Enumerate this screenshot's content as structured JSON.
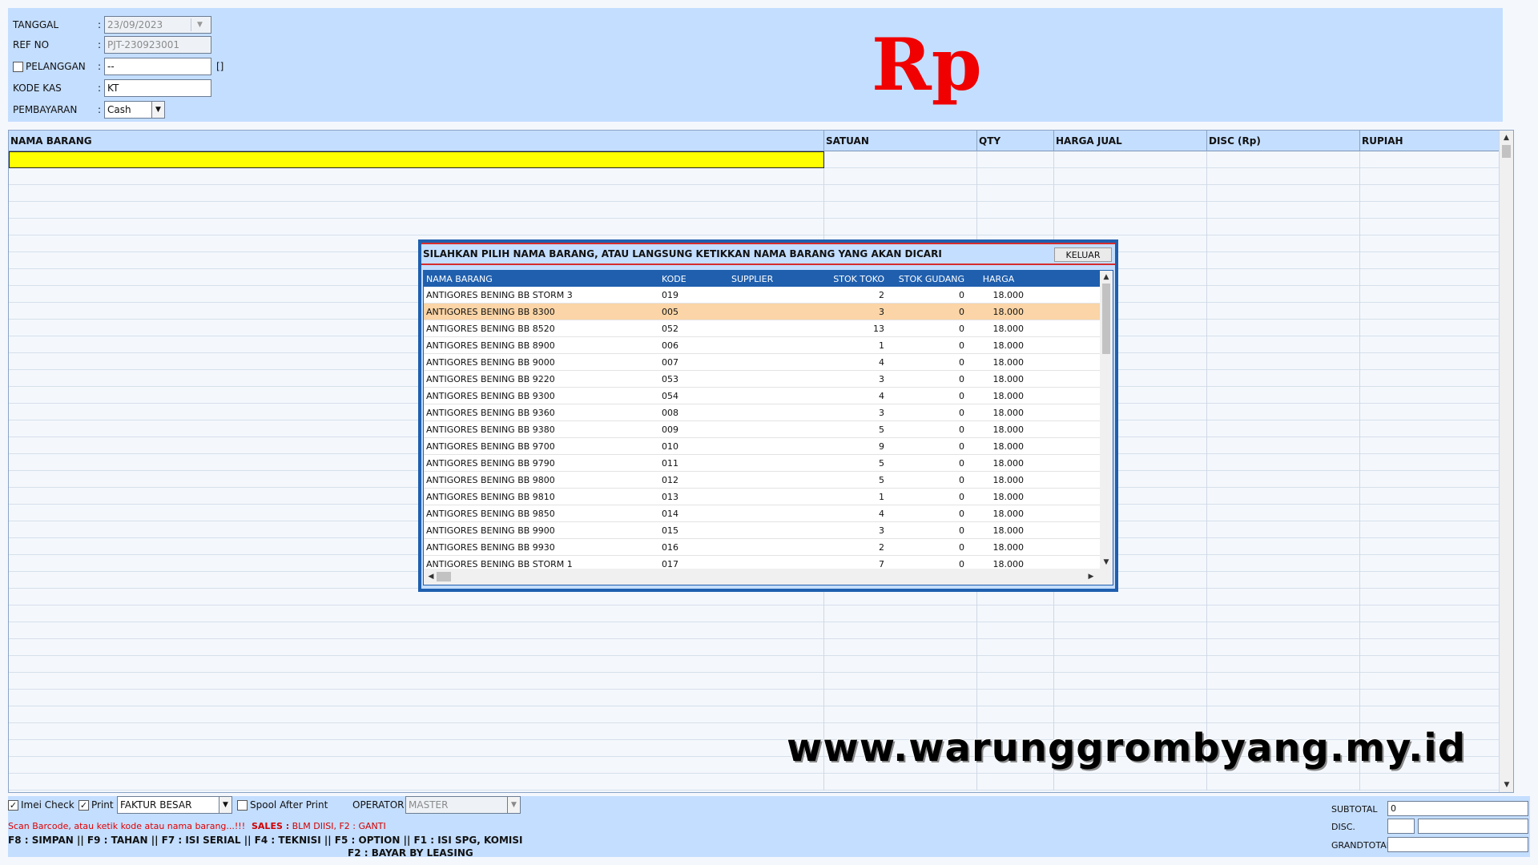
{
  "header": {
    "tanggal_label": "TANGGAL",
    "tanggal_value": "23/09/2023",
    "refno_label": "REF NO",
    "refno_value": "PJT-230923001",
    "pelanggan_label": "PELANGGAN",
    "pelanggan_value": "--",
    "pelanggan_extra": "[]",
    "kodekas_label": "KODE KAS",
    "kodekas_value": "KT",
    "pembayaran_label": "PEMBAYARAN",
    "pembayaran_value": "Cash",
    "colon": ":",
    "currency_symbol": "Rp",
    "currency_color": "#f00000"
  },
  "grid": {
    "columns": [
      "NAMA BARANG",
      "SATUAN",
      "QTY",
      "HARGA JUAL",
      "DISC (Rp)",
      "RUPIAH"
    ],
    "highlight_color": "#ffff00"
  },
  "popup": {
    "title": "SILAHKAN PILIH NAMA BARANG, ATAU LANGSUNG KETIKKAN NAMA BARANG YANG AKAN DICARI",
    "close_label": "KELUAR",
    "columns": [
      "NAMA BARANG",
      "KODE",
      "SUPPLIER",
      "STOK TOKO",
      "STOK GUDANG",
      "HARGA"
    ],
    "selected_row_color": "#fbd5a7",
    "rows": [
      {
        "nama": "ANTIGORES BENING BB  STORM 3",
        "kode": "019",
        "supplier": "",
        "stok_toko": "2",
        "stok_gudang": "0",
        "harga": "18.000"
      },
      {
        "nama": "ANTIGORES BENING BB 8300",
        "kode": "005",
        "supplier": "",
        "stok_toko": "3",
        "stok_gudang": "0",
        "harga": "18.000"
      },
      {
        "nama": "ANTIGORES BENING BB 8520",
        "kode": "052",
        "supplier": "",
        "stok_toko": "13",
        "stok_gudang": "0",
        "harga": "18.000"
      },
      {
        "nama": "ANTIGORES BENING BB 8900",
        "kode": "006",
        "supplier": "",
        "stok_toko": "1",
        "stok_gudang": "0",
        "harga": "18.000"
      },
      {
        "nama": "ANTIGORES BENING BB 9000",
        "kode": "007",
        "supplier": "",
        "stok_toko": "4",
        "stok_gudang": "0",
        "harga": "18.000"
      },
      {
        "nama": "ANTIGORES BENING BB 9220",
        "kode": "053",
        "supplier": "",
        "stok_toko": "3",
        "stok_gudang": "0",
        "harga": "18.000"
      },
      {
        "nama": "ANTIGORES BENING BB 9300",
        "kode": "054",
        "supplier": "",
        "stok_toko": "4",
        "stok_gudang": "0",
        "harga": "18.000"
      },
      {
        "nama": "ANTIGORES BENING BB 9360",
        "kode": "008",
        "supplier": "",
        "stok_toko": "3",
        "stok_gudang": "0",
        "harga": "18.000"
      },
      {
        "nama": "ANTIGORES BENING BB 9380",
        "kode": "009",
        "supplier": "",
        "stok_toko": "5",
        "stok_gudang": "0",
        "harga": "18.000"
      },
      {
        "nama": "ANTIGORES BENING BB 9700",
        "kode": "010",
        "supplier": "",
        "stok_toko": "9",
        "stok_gudang": "0",
        "harga": "18.000"
      },
      {
        "nama": "ANTIGORES BENING BB 9790",
        "kode": "011",
        "supplier": "",
        "stok_toko": "5",
        "stok_gudang": "0",
        "harga": "18.000"
      },
      {
        "nama": "ANTIGORES BENING BB 9800",
        "kode": "012",
        "supplier": "",
        "stok_toko": "5",
        "stok_gudang": "0",
        "harga": "18.000"
      },
      {
        "nama": "ANTIGORES BENING BB 9810",
        "kode": "013",
        "supplier": "",
        "stok_toko": "1",
        "stok_gudang": "0",
        "harga": "18.000"
      },
      {
        "nama": "ANTIGORES BENING BB 9850",
        "kode": "014",
        "supplier": "",
        "stok_toko": "4",
        "stok_gudang": "0",
        "harga": "18.000"
      },
      {
        "nama": "ANTIGORES BENING BB 9900",
        "kode": "015",
        "supplier": "",
        "stok_toko": "3",
        "stok_gudang": "0",
        "harga": "18.000"
      },
      {
        "nama": "ANTIGORES BENING BB 9930",
        "kode": "016",
        "supplier": "",
        "stok_toko": "2",
        "stok_gudang": "0",
        "harga": "18.000"
      },
      {
        "nama": "ANTIGORES BENING BB STORM 1",
        "kode": "017",
        "supplier": "",
        "stok_toko": "7",
        "stok_gudang": "0",
        "harga": "18.000"
      }
    ]
  },
  "watermark": "www.warunggrombyang.my.id",
  "footer": {
    "imei_label": "Imei Check",
    "print_label": "Print",
    "print_format": "FAKTUR BESAR",
    "spool_label": "Spool After Print",
    "operator_label": "OPERATOR",
    "operator_value": "MASTER",
    "hint": "Scan Barcode, atau ketik kode atau nama barang...!!!",
    "sales_label": "SALES :",
    "sales_value": "BLM DIISI, F2 : GANTI",
    "shortcuts_line1": "F8 : SIMPAN || F9 : TAHAN ||  F7 : ISI SERIAL || F4 : TEKNISI || F5 : OPTION || F1 : ISI SPG, KOMISI",
    "shortcuts_line2": "F2 : BAYAR BY LEASING",
    "subtotal_label": "SUBTOTAL",
    "subtotal_value": "0",
    "disc_label": "DISC.",
    "grandtotal_label": "GRANDTOTAL",
    "checked_glyph": "✓"
  }
}
